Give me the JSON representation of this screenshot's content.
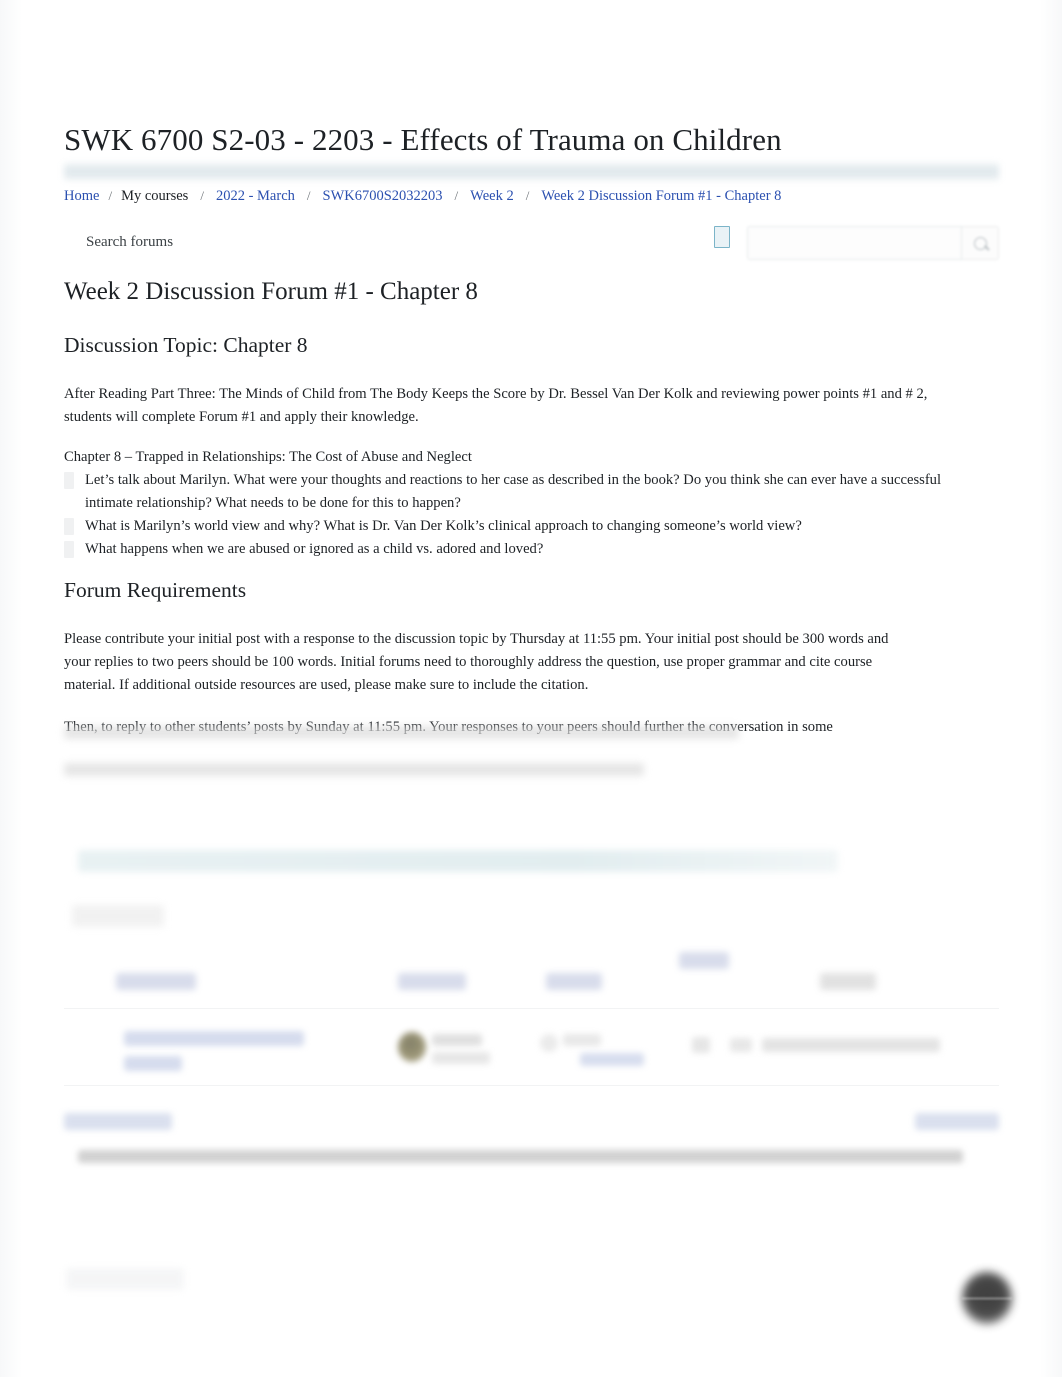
{
  "header": {
    "course_title": "SWK 6700 S2-03 - 2203 - Effects of Trauma on Children"
  },
  "breadcrumb": {
    "items": [
      {
        "label": "Home",
        "link": true
      },
      {
        "label": "My courses",
        "link": false
      },
      {
        "label": "2022 - March",
        "link": true
      },
      {
        "label": "SWK6700S2032203",
        "link": true
      },
      {
        "label": "Week 2",
        "link": true
      },
      {
        "label": "Week 2 Discussion Forum #1 - Chapter 8",
        "link": true
      }
    ],
    "separator": "/"
  },
  "toolbar": {
    "gear_icon": "gear-icon",
    "search_placeholder": "Search forums",
    "search_value": "",
    "search_icon": "search-icon"
  },
  "main": {
    "page_heading": "Week 2 Discussion Forum #1 - Chapter 8",
    "topic_heading": "Discussion Topic: Chapter 8",
    "intro_paragraph": "After Reading Part Three: The Minds of Child from      The Body Keeps the Score      by Dr. Bessel Van Der Kolk and reviewing power points #1 and # 2, students will complete Forum #1 and apply their knowledge.",
    "chapter_line": "Chapter 8 – Trapped in Relationships: The Cost of Abuse and Neglect",
    "questions": [
      "Let’s talk about Marilyn. What were your thoughts and reactions to her case as described in the book? Do you think she can ever have a successful intimate relationship? What needs to be done for this to happen?",
      "What is Marilyn’s world view and why? What is Dr. Van Der Kolk’s clinical approach to changing someone’s world view?",
      "What happens when we are abused or ignored as a child vs. adored and loved?"
    ],
    "requirements_heading": "Forum Requirements",
    "requirements_paragraph_1": "Please contribute your initial post with a response to the discussion topic by Thursday at 11:55 pm. Your initial post should be 300 words and your replies to two peers should be 100 words. Initial forums need to thoroughly address the question, use proper grammar and cite course material. If additional outside resources are used, please make sure to include the citation.",
    "requirements_paragraph_2": "Then, to reply to other students’ posts by Sunday at 11:55 pm. Your responses to your peers should further the conversation in some"
  }
}
